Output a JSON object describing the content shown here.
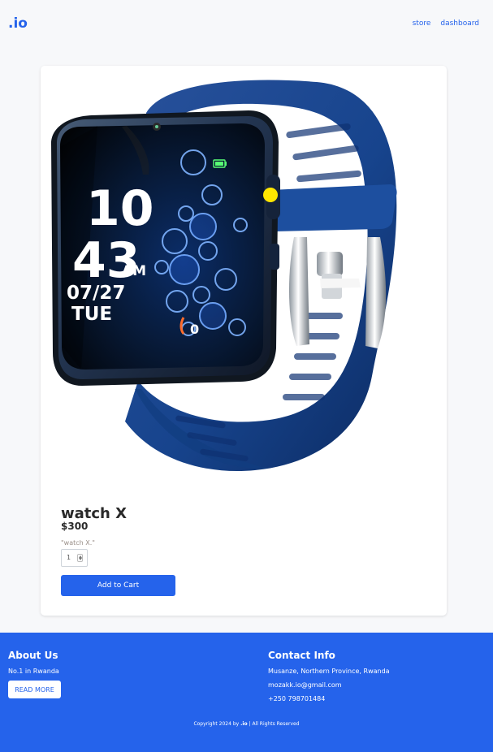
{
  "brand": {
    "logo": ".io",
    "accent": "#2563eb"
  },
  "nav": {
    "store": "store",
    "dashboard": "dashboard"
  },
  "product": {
    "name": "watch X",
    "price": "$300",
    "description": "\"watch X.\"",
    "quantity": "1",
    "add_to_cart": "Add to Cart",
    "image": "blue-smartwatch"
  },
  "watch_face": {
    "hour": "10",
    "minute": "43",
    "ampm": "AM",
    "date": "07/27",
    "day": "TUE",
    "steps": "0"
  },
  "footer": {
    "about": {
      "title": "About Us",
      "description": "No.1 in Rwanda",
      "button": "READ MORE"
    },
    "contact": {
      "title": "Contact Info",
      "address": "Musanze, Northern Province, Rwanda",
      "email": "mozakk.io@gmail.com",
      "phone": "+250 798701484"
    },
    "copyright_prefix": "Copyright 2024 by",
    "copyright_brand": ".io",
    "copyright_suffix": "| All Rights Reserved"
  }
}
